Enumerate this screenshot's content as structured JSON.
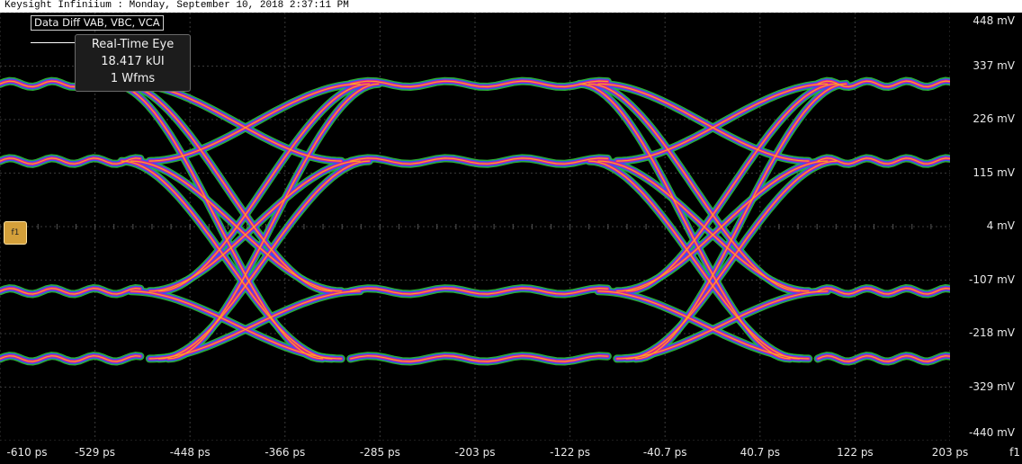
{
  "window": {
    "title": "Keysight Infiniium : Monday, September 10, 2018 2:37:11 PM"
  },
  "overlay": {
    "source_label": "Data Diff VAB, VBC, VCA",
    "measurement_box": {
      "line1": "Real-Time Eye",
      "line2": "18.417 kUI",
      "line3": "1 Wfms"
    },
    "trigger_marker_label": "f1",
    "xaxis_suffix": "f1"
  },
  "colors": {
    "background": "#000000",
    "grid": "#3a3a3a",
    "density_low": "#2fbf3a",
    "density_mid": "#3a4dff",
    "density_high": "#e0208c",
    "density_peak": "#ffb01a"
  },
  "chart_data": {
    "type": "eye-diagram",
    "x_unit": "ps",
    "y_unit": "mV",
    "xlim": [
      -610,
      203
    ],
    "ylim": [
      -440,
      448
    ],
    "x_ticks": [
      "-610 ps",
      "-529 ps",
      "-448 ps",
      "-366 ps",
      "-285 ps",
      "-203 ps",
      "-122 ps",
      "-40.7 ps",
      "40.7 ps",
      "122 ps",
      "203 ps"
    ],
    "y_ticks": [
      "448 mV",
      "337 mV",
      "226 mV",
      "115 mV",
      "4 mV",
      "-107 mV",
      "-218 mV",
      "-329 mV",
      "-440 mV"
    ],
    "levels_mV": [
      300,
      140,
      -130,
      -270
    ],
    "crossings_ps": [
      -400,
      0
    ],
    "grid": true,
    "traces": [
      {
        "name": "",
        "x": [
          -610,
          -460,
          -380,
          -330,
          -200,
          -60,
          203
        ],
        "y": [
          290,
          290,
          130,
          220,
          290,
          300,
          290
        ]
      }
    ]
  }
}
